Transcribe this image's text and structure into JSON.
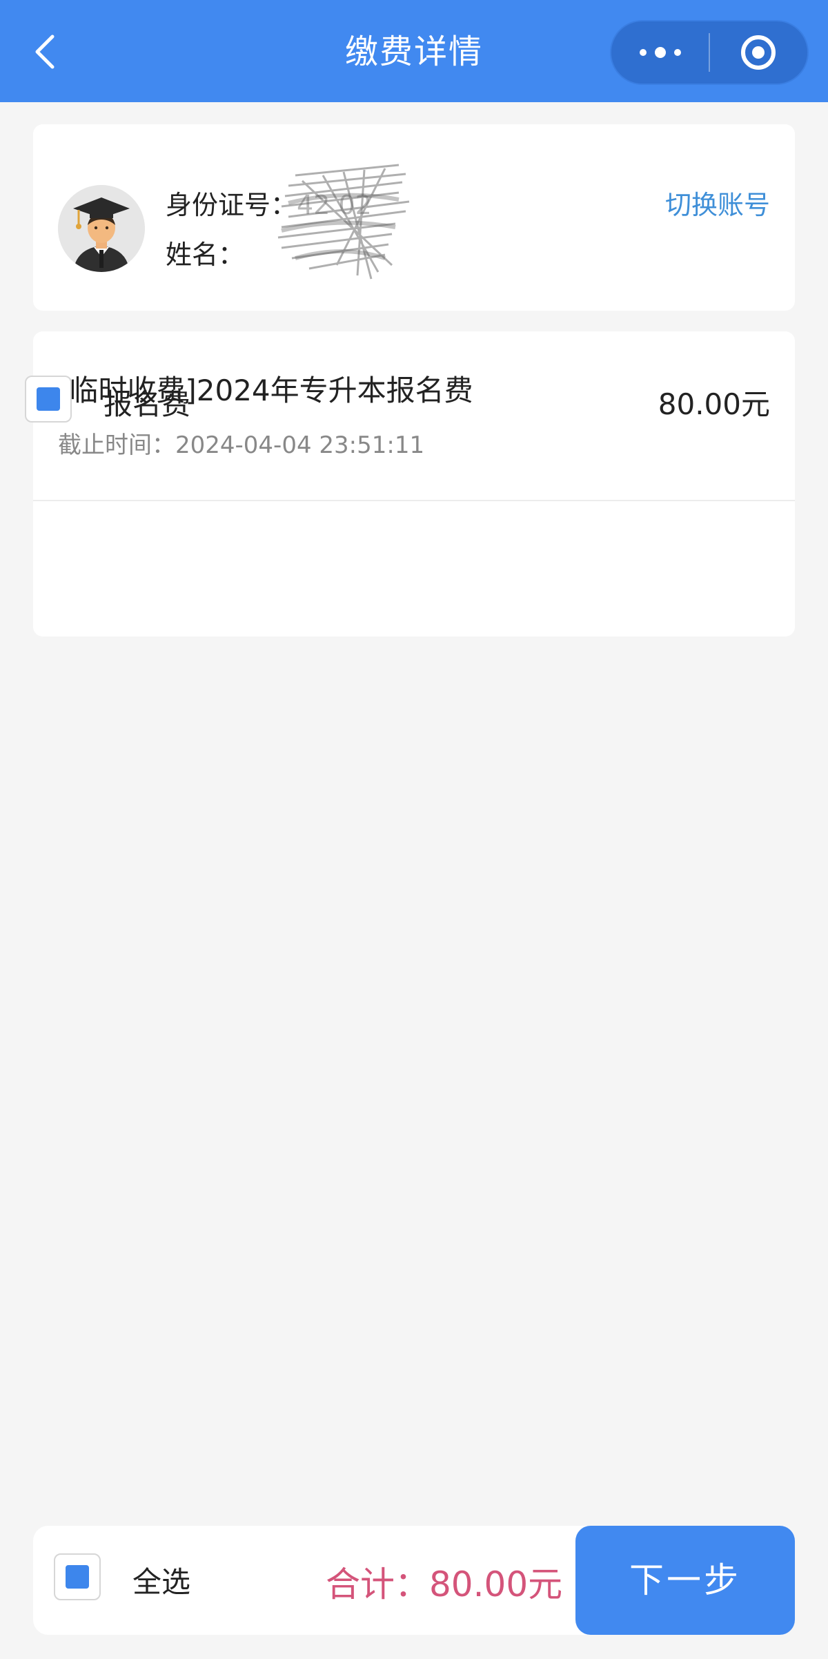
{
  "header": {
    "title": "缴费详情",
    "back_icon": "chevron-left-icon",
    "more_icon": "more-dots-icon",
    "close_icon": "target-circle-icon",
    "background_color": "#4189f0"
  },
  "account": {
    "id_label": "身份证号：",
    "id_value_masked": "42        02",
    "name_label": "姓名：",
    "name_value_masked": "",
    "switch_label": "切换账号",
    "avatar_icon": "graduate-avatar-icon",
    "link_color": "#3f8fd8"
  },
  "fee": {
    "title": "[临时收费]2024年专升本报名费",
    "deadline_label": "截止时间：",
    "deadline_value": "2024-04-04 23:51:11",
    "items": [
      {
        "label": "报名费",
        "amount": "80.00元",
        "checked": true
      }
    ]
  },
  "bottom": {
    "select_all_label": "全选",
    "select_all_checked": true,
    "total_text": "合计：80.00元",
    "next_label": "下一步",
    "total_color": "#d4547a",
    "button_color": "#4189f0"
  }
}
